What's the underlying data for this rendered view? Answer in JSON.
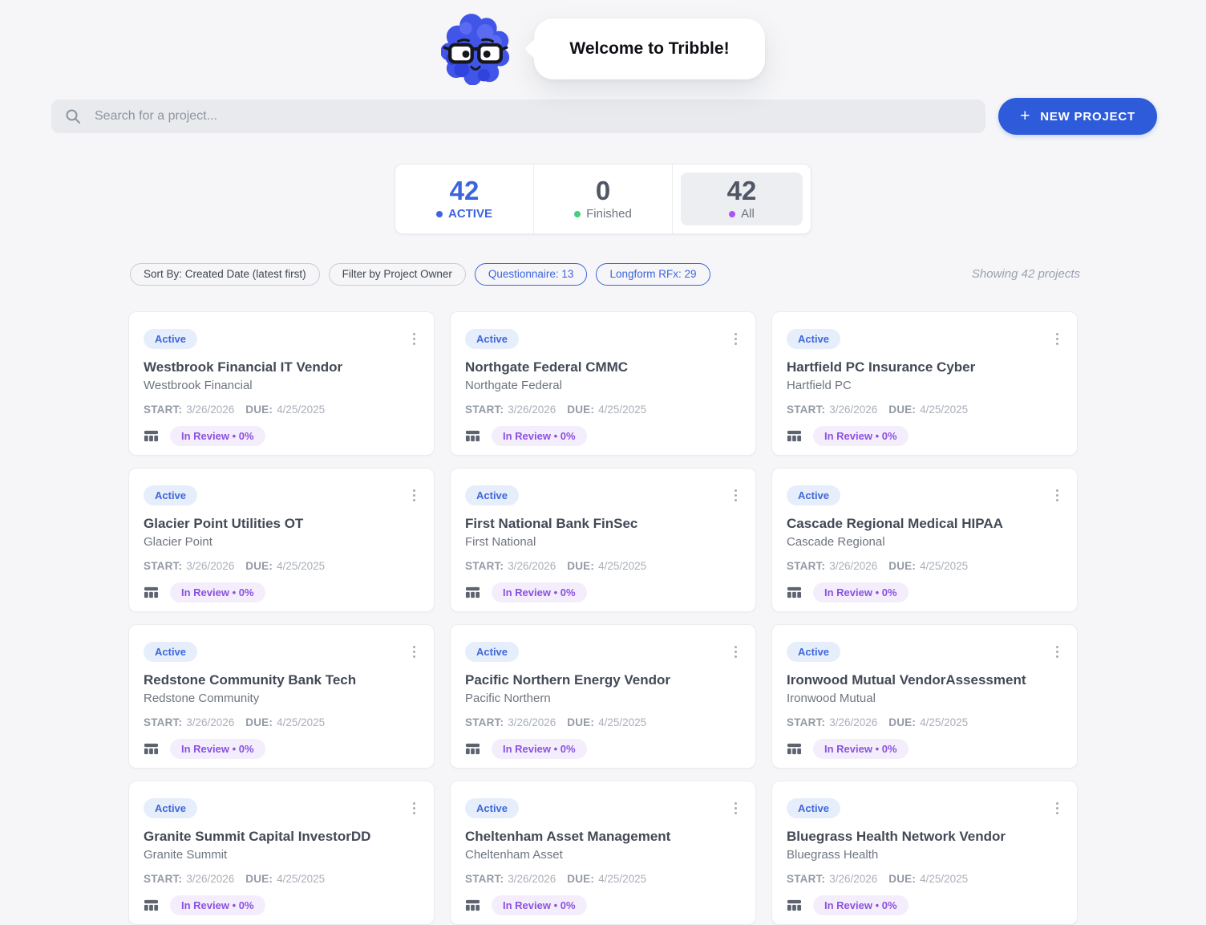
{
  "header": {
    "welcome_text": "Welcome to Tribble!",
    "mascot": "tribble-mascot-blue-scribble-with-glasses"
  },
  "search": {
    "placeholder": "Search for a project...",
    "icon": "search-icon"
  },
  "actions": {
    "new_project_label": "NEW PROJECT",
    "plus_icon": "+",
    "accent_color": "#2d5bd9"
  },
  "stats": {
    "items": [
      {
        "value": "42",
        "label": "ACTIVE",
        "dot_color": "#3e63e0",
        "selected": false
      },
      {
        "value": "0",
        "label": "Finished",
        "dot_color": "#43cf7c",
        "selected": false
      },
      {
        "value": "42",
        "label": "All",
        "dot_color": "#a855f7",
        "selected": true
      }
    ]
  },
  "filters": {
    "chips": [
      {
        "label": "Sort By: Created Date (latest first)",
        "style": "neutral"
      },
      {
        "label": "Filter by Project Owner",
        "style": "neutral"
      },
      {
        "label": "Questionnaire: 13",
        "style": "accent"
      },
      {
        "label": "Longform RFx: 29",
        "style": "accent"
      }
    ],
    "showing_text": "Showing 42 projects"
  },
  "card_common": {
    "status": "Active",
    "status_color": "#3e68d9",
    "start_label": "START:",
    "start_date": "3/26/2026",
    "due_label": "DUE:",
    "due_date": "4/25/2025",
    "progress": "In Review • 0%",
    "progress_color": "#8b51e0",
    "type_icon": "table-icon",
    "menu_icon": "kebab-menu-icon"
  },
  "cards": [
    {
      "title": "Westbrook Financial IT Vendor",
      "subtitle": "Westbrook Financial"
    },
    {
      "title": "Northgate Federal CMMC",
      "subtitle": "Northgate Federal"
    },
    {
      "title": "Hartfield PC Insurance Cyber",
      "subtitle": "Hartfield PC"
    },
    {
      "title": "Glacier Point Utilities OT",
      "subtitle": "Glacier Point"
    },
    {
      "title": "First National Bank FinSec",
      "subtitle": "First National"
    },
    {
      "title": "Cascade Regional Medical HIPAA",
      "subtitle": "Cascade Regional"
    },
    {
      "title": "Redstone Community Bank Tech",
      "subtitle": "Redstone Community"
    },
    {
      "title": "Pacific Northern Energy Vendor",
      "subtitle": "Pacific Northern"
    },
    {
      "title": "Ironwood Mutual VendorAssessment",
      "subtitle": "Ironwood Mutual"
    },
    {
      "title": "Granite Summit Capital InvestorDD",
      "subtitle": "Granite Summit"
    },
    {
      "title": "Cheltenham Asset Management",
      "subtitle": "Cheltenham Asset"
    },
    {
      "title": "Bluegrass Health Network Vendor",
      "subtitle": "Bluegrass Health"
    }
  ]
}
